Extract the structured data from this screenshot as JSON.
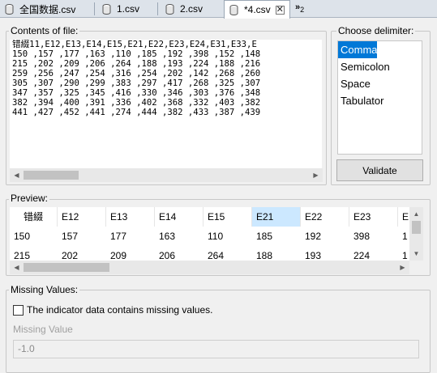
{
  "tabs": [
    {
      "label": "全国数据.csv",
      "active": false
    },
    {
      "label": "1.csv",
      "active": false
    },
    {
      "label": "2.csv",
      "active": false
    },
    {
      "label": "*4.csv",
      "active": true
    }
  ],
  "tab_overflow": {
    "symbol": "»",
    "count": "2"
  },
  "contents": {
    "title": "Contents of file:",
    "lines": [
      "错綴11,E12,E13,E14,E15,E21,E22,E23,E24,E31,E33,E",
      "150 ,157 ,177 ,163 ,110 ,185 ,192 ,398 ,152 ,148",
      "215 ,202 ,209 ,206 ,264 ,188 ,193 ,224 ,188 ,216",
      "259 ,256 ,247 ,254 ,316 ,254 ,202 ,142 ,268 ,260",
      "305 ,307 ,290 ,299 ,383 ,297 ,417 ,268 ,325 ,307",
      "347 ,357 ,325 ,345 ,416 ,330 ,346 ,303 ,376 ,348",
      "382 ,394 ,400 ,391 ,336 ,402 ,368 ,332 ,403 ,382",
      "441 ,427 ,452 ,441 ,274 ,444 ,382 ,433 ,387 ,439"
    ]
  },
  "delimiter": {
    "title": "Choose delimiter:",
    "options": [
      "Comma",
      "Semicolon",
      "Space",
      "Tabulator"
    ],
    "selected": "Comma",
    "validate_label": "Validate"
  },
  "preview": {
    "title": "Preview:",
    "headers": [
      "错綴",
      "E12",
      "E13",
      "E14",
      "E15",
      "E21",
      "E22",
      "E23",
      "E"
    ],
    "highlighted_header": "E21",
    "rows": [
      [
        "150",
        "157",
        "177",
        "163",
        "110",
        "185",
        "192",
        "398",
        "1"
      ],
      [
        "215",
        "202",
        "209",
        "206",
        "264",
        "188",
        "193",
        "224",
        "1"
      ]
    ]
  },
  "missing": {
    "title": "Missing Values:",
    "checkbox_label": "The indicator data contains missing values.",
    "checked": false,
    "value_label": "Missing Value",
    "value": "-1.0"
  },
  "colors": {
    "selection": "#0078d7",
    "header_highlight": "#cce8ff",
    "tabbar": "#dde3ea"
  }
}
